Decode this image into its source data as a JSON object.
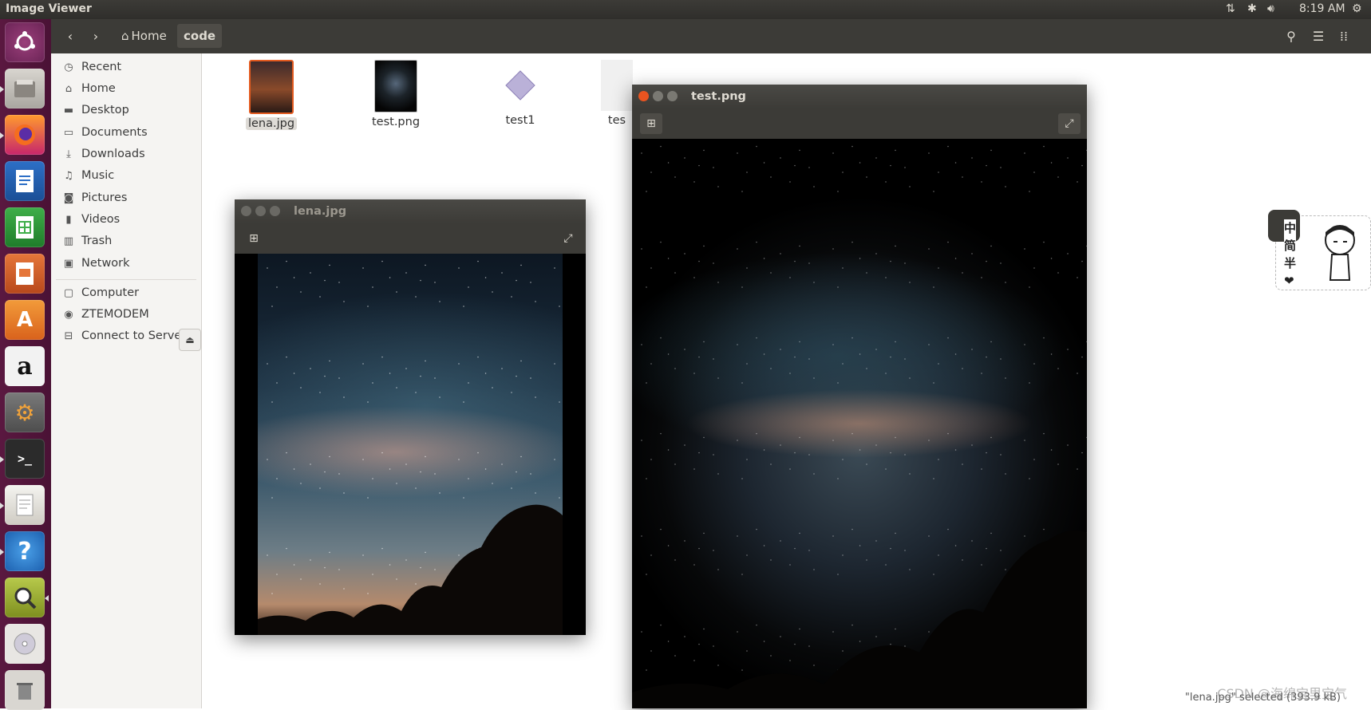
{
  "topbar": {
    "app_title": "Image Viewer",
    "clock": "8:19 AM",
    "indicators": [
      "network-icon",
      "bluetooth-icon",
      "volume-icon",
      "gear-icon"
    ]
  },
  "launcher": {
    "items": [
      "ubuntu-dash-icon",
      "files-icon",
      "firefox-icon",
      "writer-icon",
      "calc-icon",
      "impress-icon",
      "software-center-icon",
      "amazon-icon",
      "system-settings-icon",
      "terminal-icon",
      "text-editor-icon",
      "help-icon",
      "image-viewer-icon",
      "dvd-icon",
      "trash-icon"
    ],
    "accent": "#5a1840"
  },
  "nautilus": {
    "breadcrumbs": [
      {
        "label": "Home",
        "icon": "home-icon"
      },
      {
        "label": "code"
      }
    ],
    "sidebar": {
      "places": [
        {
          "label": "Recent",
          "icon": "clock-icon"
        },
        {
          "label": "Home",
          "icon": "home-icon"
        },
        {
          "label": "Desktop",
          "icon": "folder-icon"
        },
        {
          "label": "Documents",
          "icon": "documents-icon"
        },
        {
          "label": "Downloads",
          "icon": "download-icon"
        },
        {
          "label": "Music",
          "icon": "music-icon"
        },
        {
          "label": "Pictures",
          "icon": "camera-icon"
        },
        {
          "label": "Videos",
          "icon": "video-icon"
        },
        {
          "label": "Trash",
          "icon": "trash-icon"
        },
        {
          "label": "Network",
          "icon": "network-icon"
        }
      ],
      "devices": [
        {
          "label": "Computer",
          "icon": "computer-icon"
        },
        {
          "label": "ZTEMODEM",
          "icon": "disc-icon"
        },
        {
          "label": "Connect to Server",
          "icon": "server-icon"
        }
      ]
    },
    "files": [
      {
        "name": "lena.jpg",
        "selected": true
      },
      {
        "name": "test.png",
        "selected": false
      },
      {
        "name": "test1",
        "selected": false
      },
      {
        "name": "tes",
        "selected": false
      }
    ],
    "status": "\"lena.jpg\" selected (393.9 kB)",
    "watermark": "CSDN @海绵宝里宝气"
  },
  "viewers": [
    {
      "title": "lena.jpg"
    },
    {
      "title": "test.png"
    }
  ],
  "sticker": {
    "chars": [
      "中",
      "简",
      "半",
      "❤"
    ]
  }
}
